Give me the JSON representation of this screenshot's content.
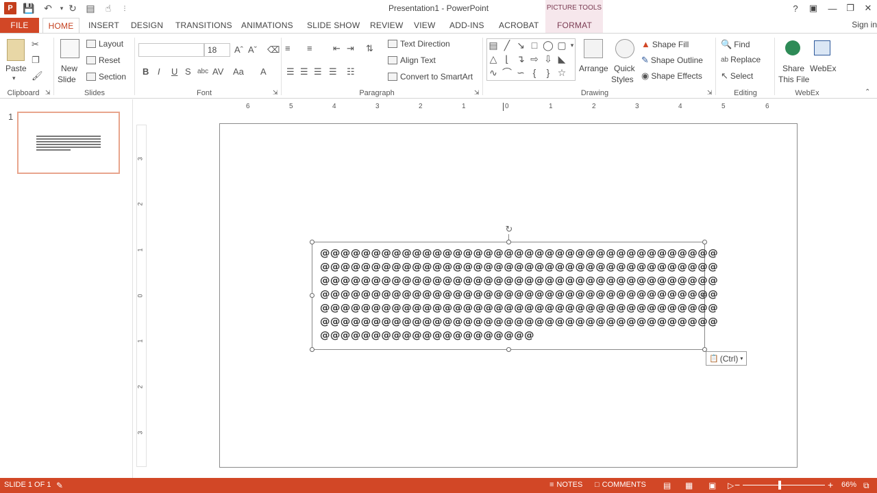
{
  "window": {
    "title": "Presentation1 - PowerPoint",
    "context_tab_group": "PICTURE TOOLS",
    "sign_in": "Sign in",
    "controls": [
      "?",
      "▣",
      "—",
      "❐",
      "✕"
    ]
  },
  "tabs": [
    {
      "label": "FILE"
    },
    {
      "label": "HOME"
    },
    {
      "label": "INSERT"
    },
    {
      "label": "DESIGN"
    },
    {
      "label": "TRANSITIONS"
    },
    {
      "label": "ANIMATIONS"
    },
    {
      "label": "SLIDE SHOW"
    },
    {
      "label": "REVIEW"
    },
    {
      "label": "VIEW"
    },
    {
      "label": "ADD-INS"
    },
    {
      "label": "ACROBAT"
    },
    {
      "label": "FORMAT"
    }
  ],
  "ribbon": {
    "clipboard": {
      "label": "Clipboard",
      "paste": "Paste"
    },
    "slides": {
      "label": "Slides",
      "new_slide_1": "New",
      "new_slide_2": "Slide",
      "layout": "Layout",
      "reset": "Reset",
      "section": "Section"
    },
    "font": {
      "label": "Font",
      "font_name": "",
      "font_size": "18"
    },
    "paragraph": {
      "label": "Paragraph",
      "text_direction": "Text Direction",
      "align_text": "Align Text",
      "convert_smartart": "Convert to SmartArt"
    },
    "drawing": {
      "label": "Drawing",
      "arrange": "Arrange",
      "quick_styles_1": "Quick",
      "quick_styles_2": "Styles",
      "shape_fill": "Shape Fill",
      "shape_outline": "Shape Outline",
      "shape_effects": "Shape Effects"
    },
    "editing": {
      "label": "Editing",
      "find": "Find",
      "replace": "Replace",
      "select": "Select"
    },
    "webex": {
      "label": "WebEx",
      "share_1": "Share",
      "share_2": "This File",
      "webex": "WebEx"
    }
  },
  "thumbnails": [
    {
      "number": "1"
    }
  ],
  "ruler": {
    "horizontal": [
      "6",
      "5",
      "4",
      "3",
      "2",
      "1",
      "0",
      "1",
      "2",
      "3",
      "4",
      "5",
      "6"
    ],
    "vertical": [
      "3",
      "2",
      "1",
      "0",
      "1",
      "2",
      "3"
    ]
  },
  "slide": {
    "text_lines": [
      "@@@@@@@@@@@@@@@@@@@@@@@@@@@@@@@@@@@@@@@",
      "@@@@@@@@@@@@@@@@@@@@@@@@@@@@@@@@@@@@@@@",
      "@@@@@@@@@@@@@@@@@@@@@@@@@@@@@@@@@@@@@@@",
      "@@@@@@@@@@@@@@@@@@@@@@@@@@@@@@@@@@@@@@@",
      "@@@@@@@@@@@@@@@@@@@@@@@@@@@@@@@@@@@@@@@",
      "@@@@@@@@@@@@@@@@@@@@@@@@@@@@@@@@@@@@@@@",
      "@@@@@@@@@@@@@@@@@@@@@"
    ],
    "paste_options": "(Ctrl)"
  },
  "status": {
    "slide_info": "SLIDE 1 OF 1",
    "notes": "NOTES",
    "comments": "COMMENTS",
    "zoom": "66%",
    "zoom_level_fraction": 0.45
  }
}
